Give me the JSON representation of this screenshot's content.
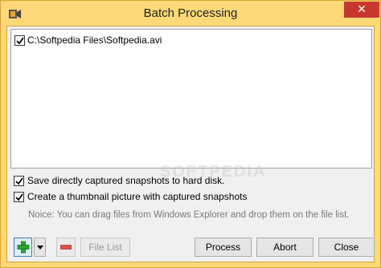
{
  "window": {
    "title": "Batch Processing",
    "close_glyph": "✕",
    "app_icon": "movie-camera-icon"
  },
  "file_list": {
    "items": [
      {
        "checked": true,
        "path": "C:\\Softpedia Files\\Softpedia.avi"
      }
    ]
  },
  "options": {
    "save_directly": {
      "checked": true,
      "label": "Save directly captured snapshots to hard disk."
    },
    "create_thumbnail": {
      "checked": true,
      "label": "Create a thumbnail picture with captured snapshots"
    }
  },
  "notice": "Noice: You can drag files from Windows Explorer and drop them on the file list.",
  "buttons": {
    "add_icon": "green-plus-icon",
    "dropdown_icon": "triangle-down-icon",
    "remove_icon": "red-minus-icon",
    "file_list": "File List",
    "process": "Process",
    "abort": "Abort",
    "close": "Close"
  },
  "watermark": "SOFTPEDIA",
  "colors": {
    "frame": "#ffd878",
    "close_button": "#c7372f",
    "add_icon_green": "#2fa52f",
    "remove_icon_red": "#e0504a"
  }
}
